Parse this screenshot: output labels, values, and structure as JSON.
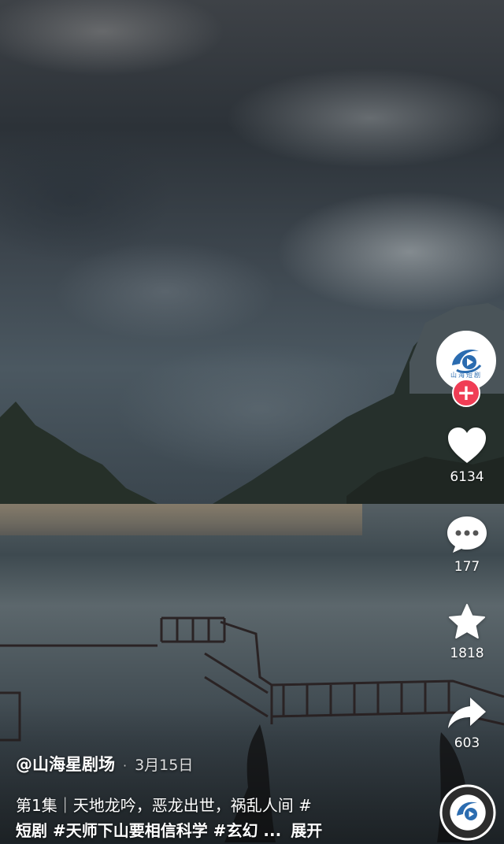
{
  "account": {
    "avatar_label": "山海短剧",
    "follow_symbol": "+"
  },
  "actions": {
    "like_count": "6134",
    "comment_count": "177",
    "favorite_count": "1818",
    "share_count": "603"
  },
  "caption": {
    "author": "@山海星剧场",
    "separator": "·",
    "date": "3月15日",
    "episode": "第1集｜天地龙吟，恶龙出世，祸乱人间 #",
    "tags_line": "短剧 #天师下山要相信科学 #玄幻 ...",
    "expand_label": "展开"
  },
  "colors": {
    "follow_badge": "#f03d55",
    "logo_blue": "#2b6cb0",
    "icon_white": "#ffffff"
  },
  "icons": [
    "heart-icon",
    "comment-icon",
    "star-icon",
    "share-icon",
    "plus-icon",
    "music-disc-icon"
  ]
}
